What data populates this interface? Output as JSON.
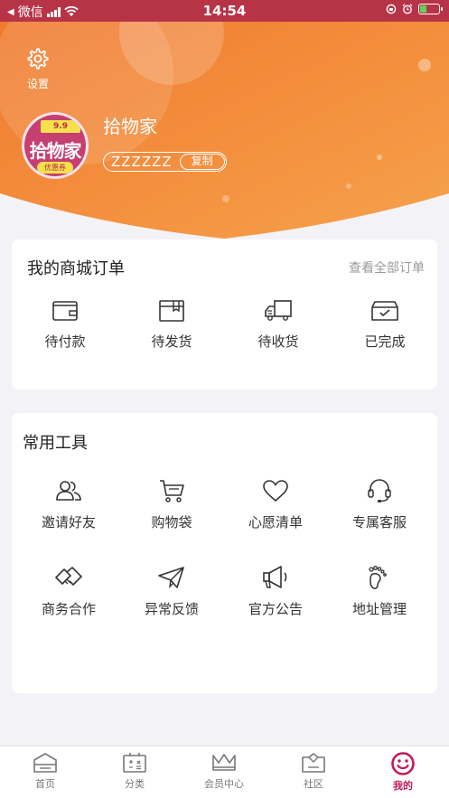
{
  "status_bar": {
    "carrier": "微信",
    "time": "14:54",
    "battery_level": 0.35
  },
  "header": {
    "settings_label": "设置",
    "avatar": {
      "tag": "9.9",
      "text": "拾物家",
      "coupon": "优惠券"
    },
    "user_name": "拾物家",
    "user_id": "ZZZZZZ",
    "copy_label": "复制"
  },
  "orders": {
    "title": "我的商城订单",
    "view_all": "查看全部订单",
    "items": [
      {
        "label": "待付款",
        "icon": "wallet-icon"
      },
      {
        "label": "待发货",
        "icon": "package-icon"
      },
      {
        "label": "待收货",
        "icon": "truck-icon"
      },
      {
        "label": "已完成",
        "icon": "box-check-icon"
      }
    ]
  },
  "tools": {
    "title": "常用工具",
    "items": [
      {
        "label": "邀请好友",
        "icon": "users-icon"
      },
      {
        "label": "购物袋",
        "icon": "cart-icon"
      },
      {
        "label": "心愿清单",
        "icon": "heart-icon"
      },
      {
        "label": "专属客服",
        "icon": "headset-icon"
      },
      {
        "label": "商务合作",
        "icon": "handshake-icon"
      },
      {
        "label": "异常反馈",
        "icon": "paper-plane-icon"
      },
      {
        "label": "官方公告",
        "icon": "megaphone-icon"
      },
      {
        "label": "地址管理",
        "icon": "footprint-icon"
      }
    ]
  },
  "tabs": [
    {
      "label": "首页",
      "icon": "home-icon"
    },
    {
      "label": "分类",
      "icon": "category-icon"
    },
    {
      "label": "会员中心",
      "icon": "crown-icon"
    },
    {
      "label": "社区",
      "icon": "community-icon"
    },
    {
      "label": "我的",
      "icon": "smile-icon",
      "active": true
    }
  ],
  "colors": {
    "status_bar": "#b73447",
    "header_gradient_start": "#f07a2e",
    "header_gradient_end": "#f6a24c",
    "active_tab": "#c2185b"
  }
}
